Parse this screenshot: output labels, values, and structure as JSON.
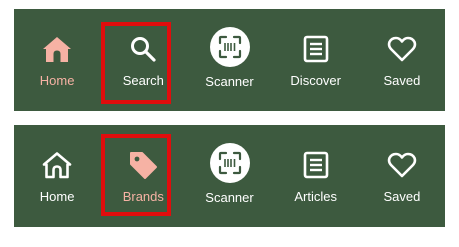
{
  "colors": {
    "bar_bg": "#3d5a3f",
    "active": "#f6b2a4",
    "inactive": "#ffffff",
    "highlight": "#e00d0d"
  },
  "nav_top": {
    "items": [
      {
        "label": "Home",
        "icon": "home-icon",
        "active": true
      },
      {
        "label": "Search",
        "icon": "search-icon",
        "active": false,
        "highlighted": true
      },
      {
        "label": "Scanner",
        "icon": "barcode-scanner-icon",
        "active": false
      },
      {
        "label": "Discover",
        "icon": "article-icon",
        "active": false
      },
      {
        "label": "Saved",
        "icon": "heart-icon",
        "active": false
      }
    ]
  },
  "nav_bottom": {
    "items": [
      {
        "label": "Home",
        "icon": "home-icon",
        "active": false
      },
      {
        "label": "Brands",
        "icon": "tag-icon",
        "active": true,
        "highlighted": true
      },
      {
        "label": "Scanner",
        "icon": "barcode-scanner-icon",
        "active": false
      },
      {
        "label": "Articles",
        "icon": "article-icon",
        "active": false
      },
      {
        "label": "Saved",
        "icon": "heart-icon",
        "active": false
      }
    ]
  }
}
